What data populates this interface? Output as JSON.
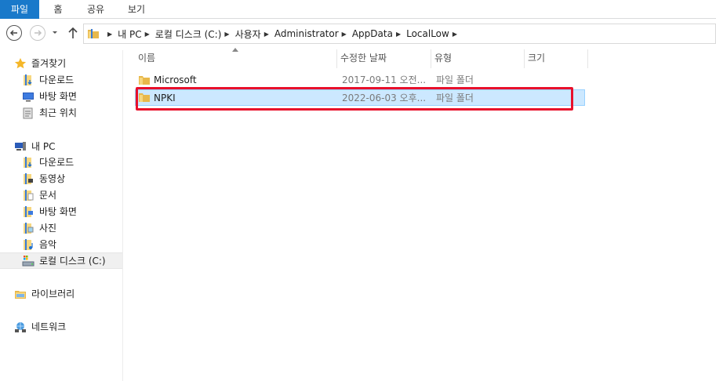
{
  "ribbon": {
    "tabs": [
      "파일",
      "홈",
      "공유",
      "보기"
    ]
  },
  "address": {
    "crumbs": [
      "내 PC",
      "로컬 디스크 (C:)",
      "사용자",
      "Administrator",
      "AppData",
      "LocalLow"
    ]
  },
  "sidebar": {
    "favorites": {
      "label": "즐겨찾기",
      "items": [
        "다운로드",
        "바탕 화면",
        "최근 위치"
      ]
    },
    "pc": {
      "label": "내 PC",
      "items": [
        "다운로드",
        "동영상",
        "문서",
        "바탕 화면",
        "사진",
        "음악",
        "로컬 디스크 (C:)"
      ]
    },
    "libraries": "라이브러리",
    "network": "네트워크"
  },
  "columns": [
    "이름",
    "수정한 날짜",
    "유형",
    "크기"
  ],
  "files": [
    {
      "name": "Microsoft",
      "date": "2017-09-11 오전...",
      "type": "파일 폴더",
      "size": ""
    },
    {
      "name": "NPKI",
      "date": "2022-06-03 오후...",
      "type": "파일 폴더",
      "size": ""
    }
  ],
  "colors": {
    "accent": "#1979ca",
    "selection": "#cce8ff",
    "highlight": "#e8102b",
    "folder": "#e8b84a"
  }
}
